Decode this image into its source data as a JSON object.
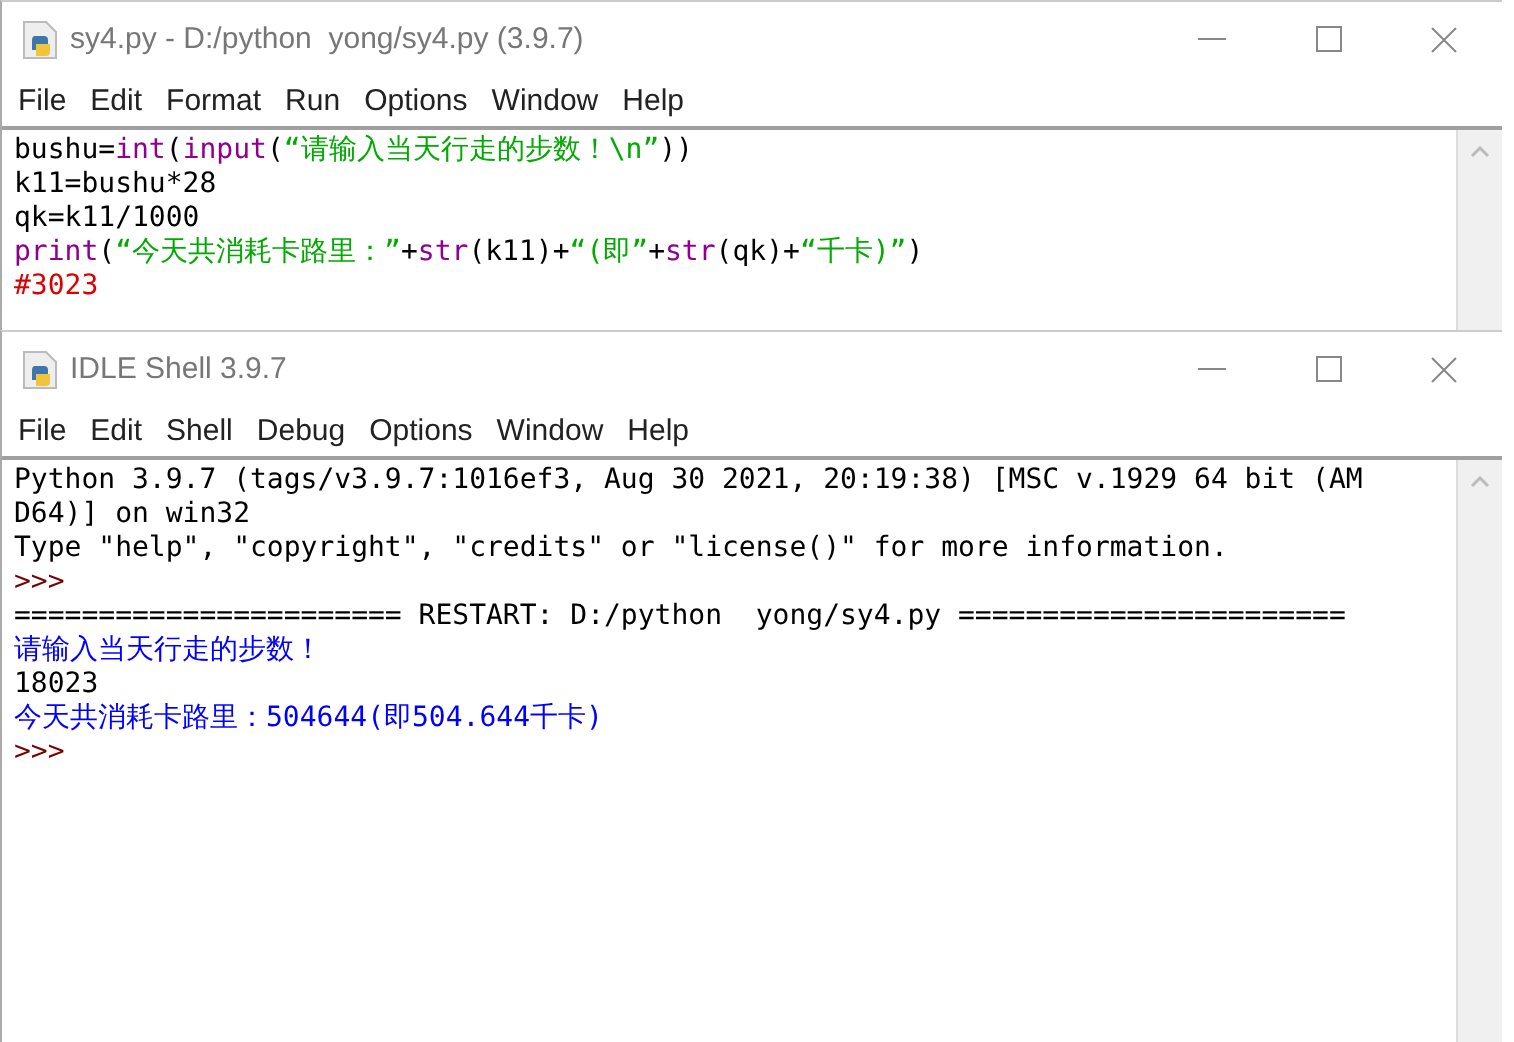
{
  "editor": {
    "window": {
      "title": "sy4.py - D:/python  yong/sy4.py (3.9.7)"
    },
    "menu": [
      "File",
      "Edit",
      "Format",
      "Run",
      "Options",
      "Window",
      "Help"
    ],
    "lines": [
      {
        "segments": [
          {
            "kind": "plain",
            "text": "bushu="
          },
          {
            "kind": "builtin",
            "text": "int"
          },
          {
            "kind": "plain",
            "text": "("
          },
          {
            "kind": "builtin",
            "text": "input"
          },
          {
            "kind": "plain",
            "text": "("
          },
          {
            "kind": "string",
            "text": "“请输入当天行走的步数！\\n”"
          },
          {
            "kind": "plain",
            "text": "))"
          }
        ]
      },
      {
        "segments": [
          {
            "kind": "plain",
            "text": "k11=bushu*28"
          }
        ]
      },
      {
        "segments": [
          {
            "kind": "plain",
            "text": "qk=k11/1000"
          }
        ]
      },
      {
        "segments": [
          {
            "kind": "builtin",
            "text": "print"
          },
          {
            "kind": "plain",
            "text": "("
          },
          {
            "kind": "string",
            "text": "“今天共消耗卡路里：”"
          },
          {
            "kind": "plain",
            "text": "+"
          },
          {
            "kind": "builtin",
            "text": "str"
          },
          {
            "kind": "plain",
            "text": "(k11)+"
          },
          {
            "kind": "string",
            "text": "“(即”"
          },
          {
            "kind": "plain",
            "text": "+"
          },
          {
            "kind": "builtin",
            "text": "str"
          },
          {
            "kind": "plain",
            "text": "(qk)+"
          },
          {
            "kind": "string",
            "text": "“千卡)”"
          },
          {
            "kind": "plain",
            "text": ")"
          }
        ]
      },
      {
        "segments": [
          {
            "kind": "comment",
            "text": "#3023"
          }
        ]
      }
    ]
  },
  "shell": {
    "window": {
      "title": "IDLE Shell 3.9.7"
    },
    "menu": [
      "File",
      "Edit",
      "Shell",
      "Debug",
      "Options",
      "Window",
      "Help"
    ],
    "lines": [
      {
        "segments": [
          {
            "kind": "plain",
            "text": "Python 3.9.7 (tags/v3.9.7:1016ef3, Aug 30 2021, 20:19:38) [MSC v.1929 64 bit (AM"
          }
        ]
      },
      {
        "segments": [
          {
            "kind": "plain",
            "text": "D64)] on win32"
          }
        ]
      },
      {
        "segments": [
          {
            "kind": "plain",
            "text": "Type \"help\", \"copyright\", \"credits\" or \"license()\" for more information."
          }
        ]
      },
      {
        "segments": [
          {
            "kind": "prompt",
            "text": ">>>"
          }
        ]
      },
      {
        "segments": [
          {
            "kind": "plain",
            "text": "======================= RESTART: D:/python  yong/sy4.py ======================="
          }
        ]
      },
      {
        "segments": [
          {
            "kind": "stdout",
            "text": "请输入当天行走的步数！"
          }
        ]
      },
      {
        "segments": [
          {
            "kind": "plain",
            "text": "18023"
          }
        ]
      },
      {
        "segments": [
          {
            "kind": "stdout",
            "text": "今天共消耗卡路里：504644(即504.644千卡)"
          }
        ]
      },
      {
        "segments": [
          {
            "kind": "prompt",
            "text": ">>>"
          }
        ]
      }
    ]
  }
}
